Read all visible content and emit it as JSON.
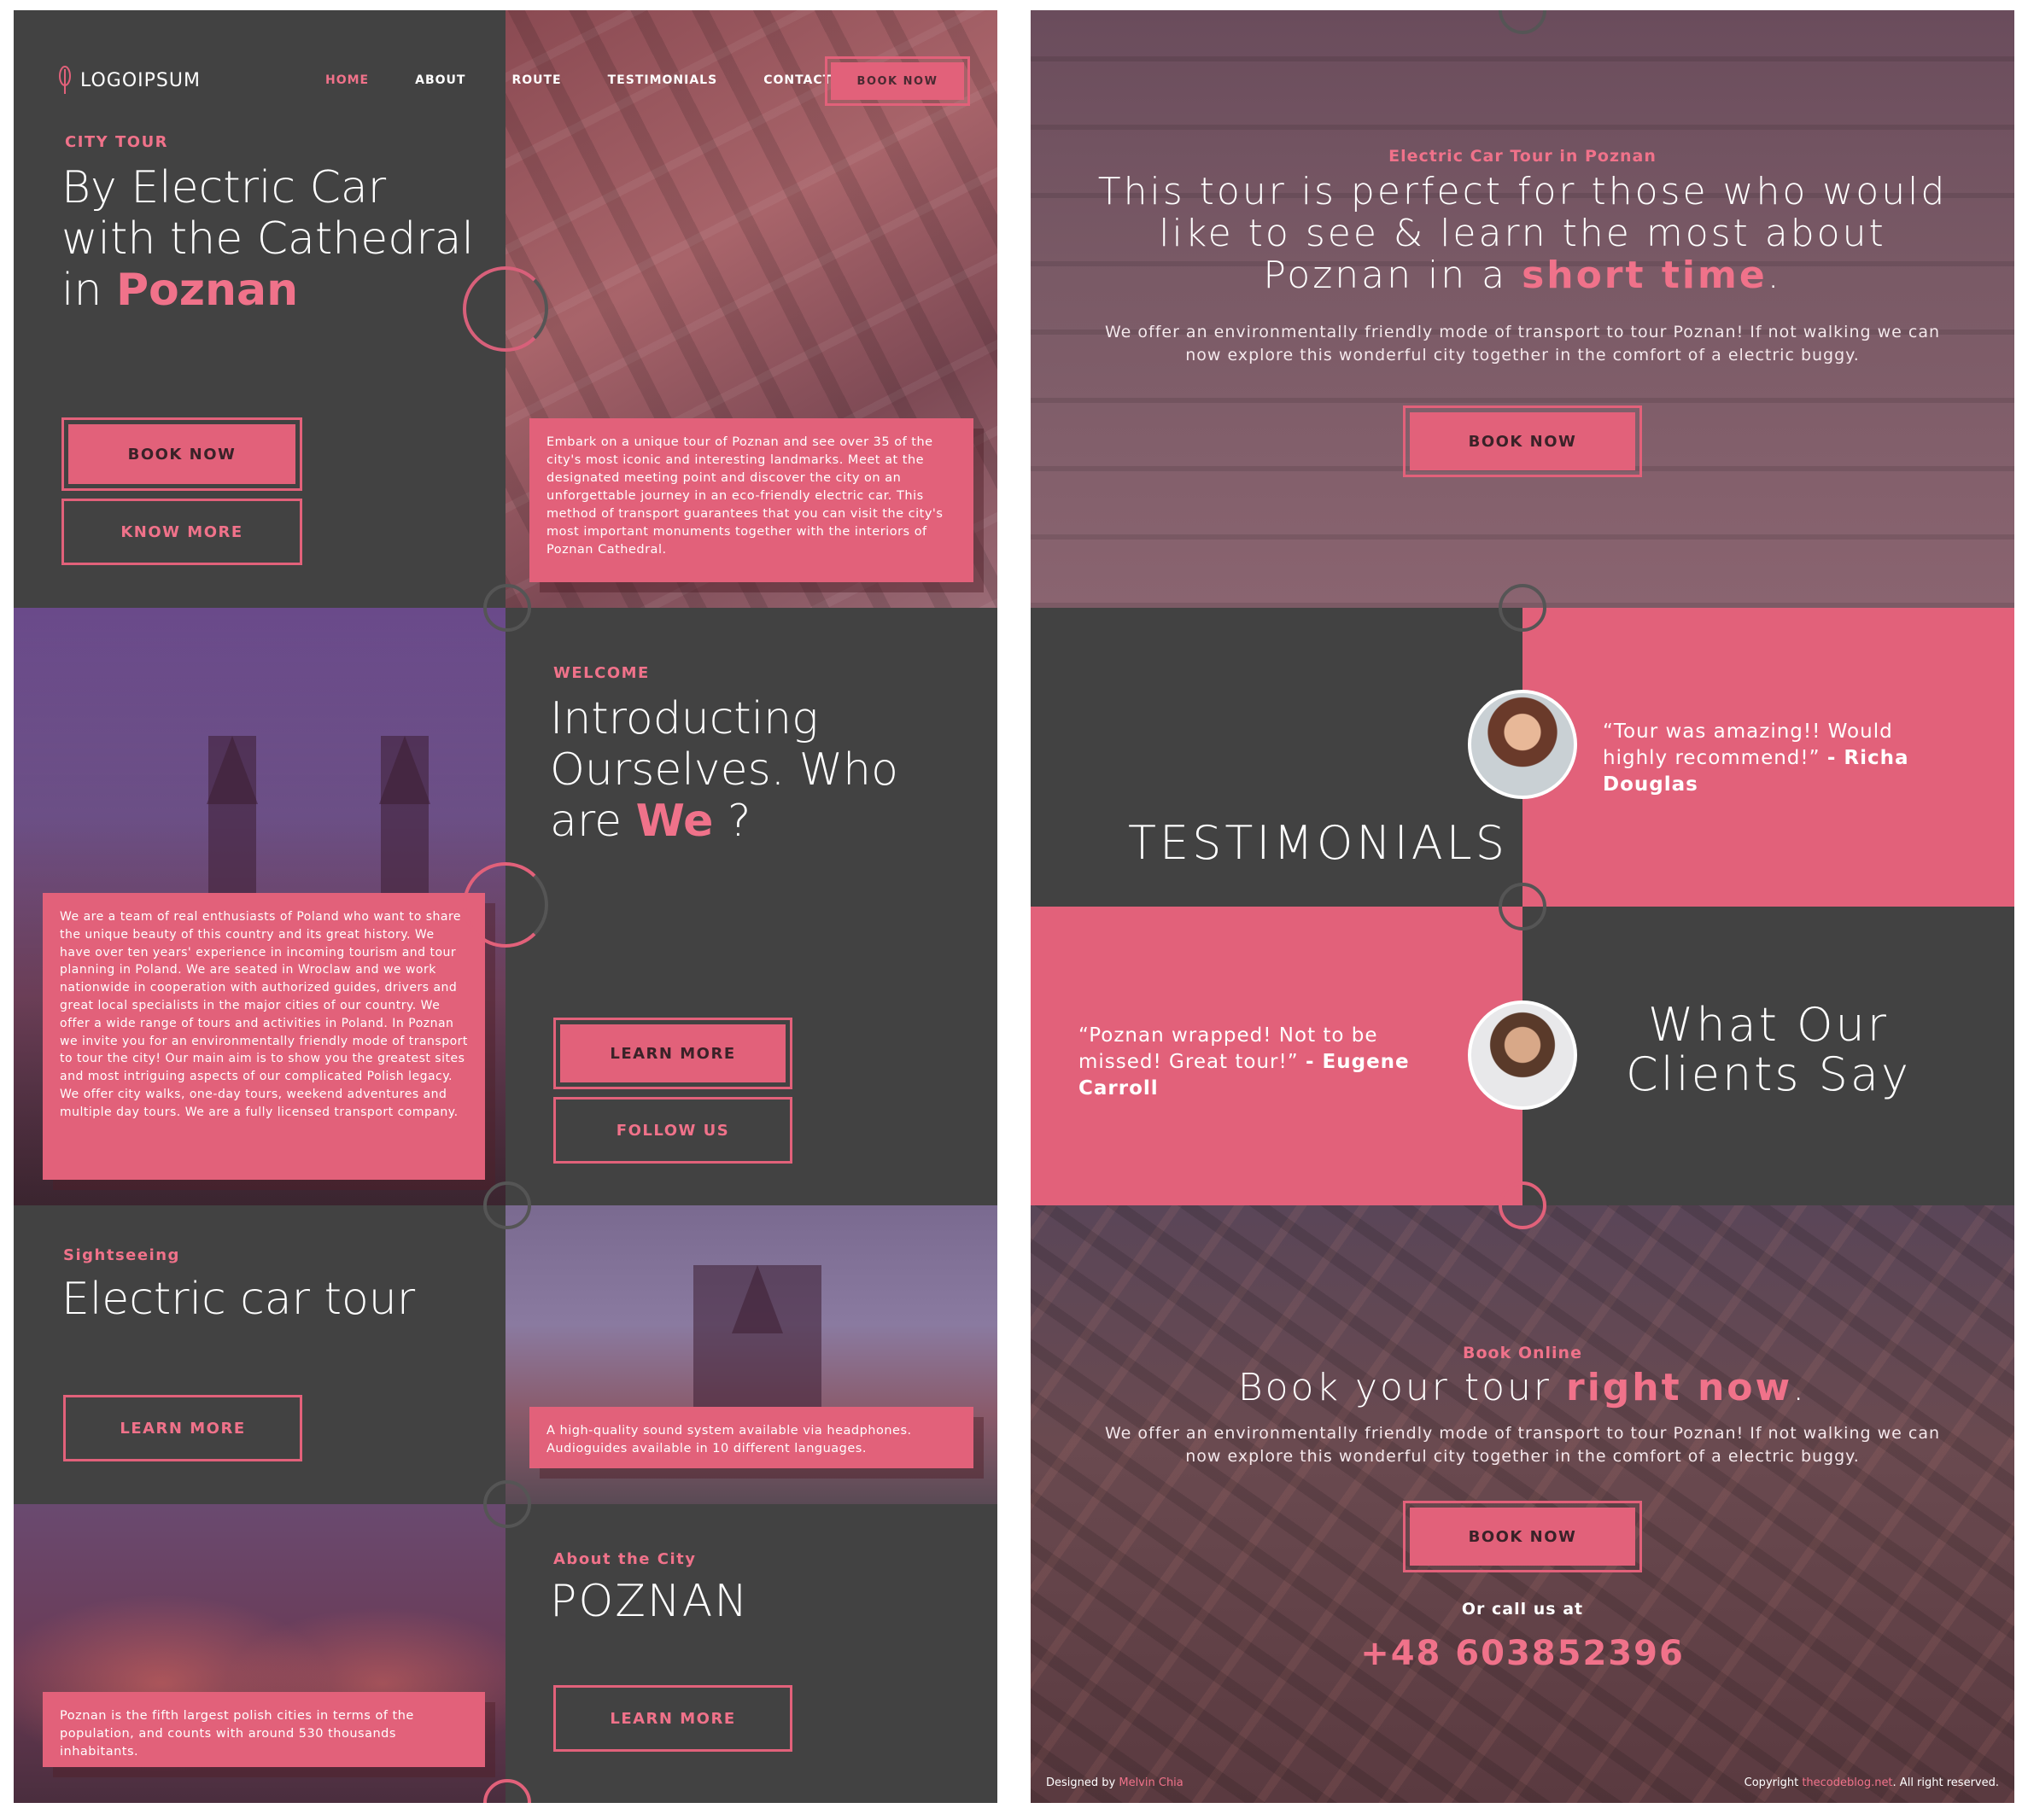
{
  "nav": {
    "logo_text": "LOGOIPSUM",
    "links": [
      "HOME",
      "ABOUT",
      "ROUTE",
      "TESTIMONIALS",
      "CONTACT"
    ],
    "book_label": "BOOK NOW"
  },
  "hero": {
    "kicker": "CITY TOUR",
    "title_line1": "By Electric Car",
    "title_line2": "with the Cathedral",
    "title_line3_prefix": "in ",
    "title_accent": "Poznan",
    "book_label": "BOOK NOW",
    "know_label": "KNOW MORE",
    "card_text": "Embark on a unique tour of Poznan and see over 35 of the city's most iconic and interesting landmarks. Meet at the designated meeting point and discover the city on an unforgettable journey in an eco-friendly electric car. This method of transport guarantees that you can visit the city's most important monuments together with the interiors of Poznan Cathedral."
  },
  "welcome": {
    "kicker": "WELCOME",
    "title_line1": "Introducting",
    "title_line2": "Ourselves. Who",
    "title_line3_prefix": "are ",
    "title_accent": "We",
    "title_suffix": " ?",
    "learn_label": "LEARN MORE",
    "follow_label": "FOLLOW US",
    "card_text": "We are a team of real enthusiasts of Poland who want to share the unique beauty of this country and its great history. We have over ten years' experience in incoming tourism and tour planning in Poland. We are seated in Wroclaw and we work nationwide in cooperation with authorized guides, drivers and great local specialists in the major cities of our country. We offer a wide range of tours and activities in Poland. In Poznan we invite you for an environmentally friendly mode of transport to tour the city! Our main aim is to show you the greatest sites and most intriguing aspects of our complicated Polish legacy. We offer city walks, one-day tours, weekend adventures and multiple day tours. We are a fully licensed transport company."
  },
  "sightseeing": {
    "kicker": "Sightseeing",
    "title": "Electric car tour",
    "learn_label": "LEARN MORE",
    "card_text": "A high-quality sound system available via headphones. Audioguides available in 10 different languages."
  },
  "about_city": {
    "kicker": "About the City",
    "title": "POZNAN",
    "learn_label": "LEARN MORE",
    "card_text": "Poznan is the fifth largest polish cities in terms of the population, and counts with around 530 thousands inhabitants."
  },
  "tour_intro": {
    "kicker": "Electric Car Tour in Poznan",
    "title_line1": "This tour is perfect for those who would",
    "title_line2": "like to see & learn the most about",
    "title_line3_prefix": "Poznan in a ",
    "title_accent": "short time",
    "title_suffix": ".",
    "para_line1": "We offer an environmentally friendly mode of transport to tour Poznan! If not walking we can",
    "para_line2": "now explore this wonderful city together in the comfort of a electric buggy.",
    "book_label": "BOOK NOW"
  },
  "testimonials": {
    "heading": "TESTIMONIALS",
    "clients_line1": "What Our",
    "clients_line2": "Clients Say",
    "quote1_text": "“Tour was amazing!! Would highly recommend!”",
    "quote1_author": "- Richa Douglas",
    "quote2_text": "“Poznan wrapped! Not to be missed! Great tour!”",
    "quote2_author": "- Eugene Carroll"
  },
  "booking": {
    "kicker": "Book Online",
    "title_prefix": "Book your tour ",
    "title_accent": "right now",
    "title_suffix": ".",
    "para_line1": "We offer an environmentally friendly mode of transport to tour Poznan! If not walking we can",
    "para_line2": "now explore this wonderful city together in the comfort of a electric buggy.",
    "book_label": "BOOK NOW",
    "call_label": "Or call us at",
    "phone": "+48 603852396"
  },
  "footer": {
    "designed_prefix": "Designed by ",
    "designer": "Melvin Chia",
    "copyright_prefix": "Copyright ",
    "site": "thecodeblog.net",
    "rights": ". All right reserved."
  },
  "colors": {
    "accent": "#e2617a",
    "dark": "#424242"
  }
}
